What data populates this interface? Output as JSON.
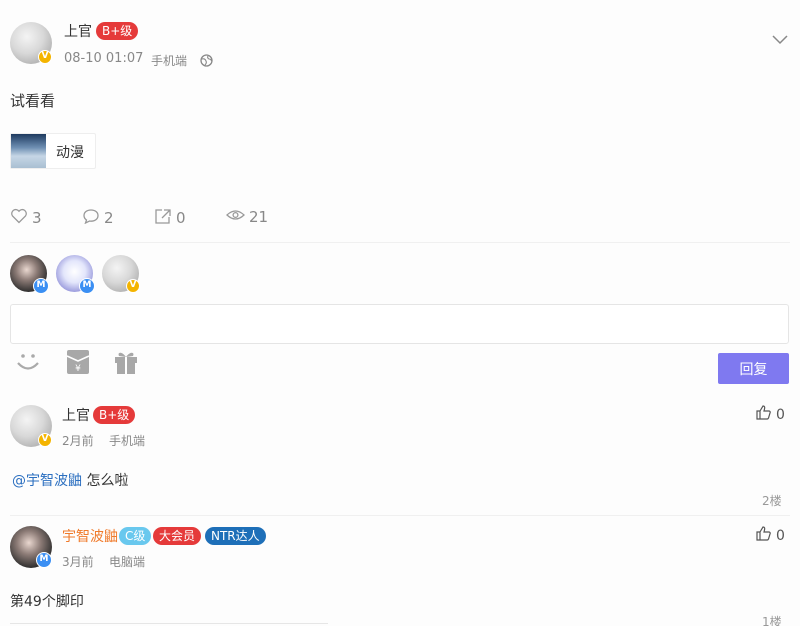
{
  "post": {
    "author": "上官",
    "level": "B+级",
    "date": "08-10 01:07",
    "device": "手机端",
    "content": "试看看",
    "tag_card_label": "动漫",
    "likes": "3",
    "comments": "2",
    "shares": "0",
    "views": "21"
  },
  "reply_box": {
    "reply_label": "回复"
  },
  "comments": [
    {
      "author": "上官",
      "level": "B+级",
      "time": "2月前",
      "device": "手机端",
      "mention": "@宇智波鼬",
      "text": "怎么啦",
      "floor": "2楼",
      "likes": "0"
    },
    {
      "author": "宇智波鼬",
      "level": "C级",
      "vip": "大会员",
      "title": "NTR达人",
      "time": "3月前",
      "device": "电脑端",
      "text": "第49个脚印",
      "floor": "1楼",
      "likes": "0"
    }
  ],
  "colors": {
    "accent_button": "#7f79f0",
    "level_tag": "#e53a3a",
    "c_level_tag": "#69c8ee",
    "ntr_tag": "#1e6fb8",
    "mention": "#2b6fc0",
    "orange_name": "#f07a2a",
    "v_badge": "#f4b400",
    "m_badge": "#3b8ff3"
  }
}
